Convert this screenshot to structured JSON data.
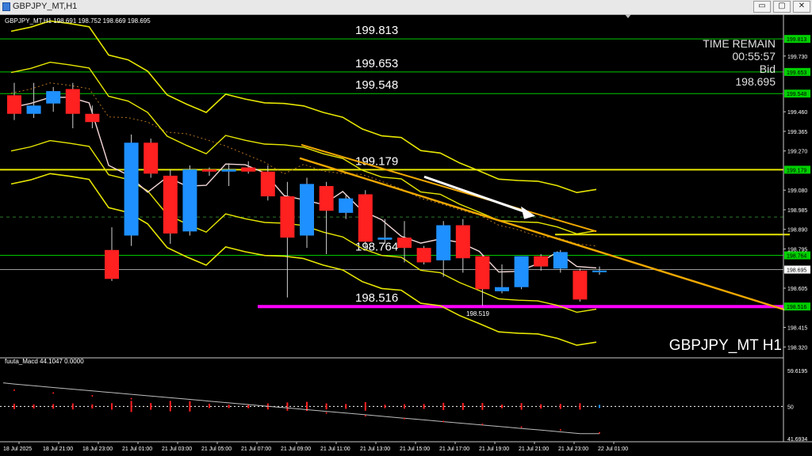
{
  "window": {
    "title": "GBPJPY_MT,H1",
    "min_glyph": "▭",
    "max_glyph": "▢",
    "close_glyph": "✕",
    "icons": [
      "app-icon",
      "minimize-icon",
      "restore-icon",
      "close-icon"
    ]
  },
  "chart_data": {
    "type": "candlestick",
    "symbol_header": "GBPJPY_MT,H1  198.691 198.752 198.669 198.695",
    "watermark": "GBPJPY_MT H1",
    "info_panel": {
      "time_remain_label": "TIME REMAIN",
      "time_remain": "00:55:57",
      "bid_label": "Bid",
      "bid": "198.695"
    },
    "y_range": [
      198.275,
      199.875
    ],
    "y_ticks": [
      "199.813",
      "199.730",
      "199.653",
      "199.548",
      "199.460",
      "199.365",
      "199.270",
      "199.179",
      "199.080",
      "198.985",
      "198.890",
      "198.795",
      "198.764",
      "198.695",
      "198.605",
      "198.516",
      "198.415",
      "198.320"
    ],
    "x_ticks": [
      "18 Jul 2025",
      "18 Jul 21:00",
      "18 Jul 23:00",
      "21 Jul 01:00",
      "21 Jul 03:00",
      "21 Jul 05:00",
      "21 Jul 07:00",
      "21 Jul 09:00",
      "21 Jul 11:00",
      "21 Jul 13:00",
      "21 Jul 15:00",
      "21 Jul 17:00",
      "21 Jul 19:00",
      "21 Jul 21:00",
      "21 Jul 23:00",
      "22 Jul 01:00"
    ],
    "candles": [
      {
        "o": 199.54,
        "h": 199.6,
        "l": 199.42,
        "c": 199.45
      },
      {
        "o": 199.45,
        "h": 199.6,
        "l": 199.43,
        "c": 199.49
      },
      {
        "o": 199.5,
        "h": 199.58,
        "l": 199.46,
        "c": 199.56
      },
      {
        "o": 199.57,
        "h": 199.6,
        "l": 199.38,
        "c": 199.45
      },
      {
        "o": 199.45,
        "h": 199.49,
        "l": 199.38,
        "c": 199.41
      },
      {
        "o": 198.79,
        "h": 198.9,
        "l": 198.64,
        "c": 198.65
      },
      {
        "o": 198.86,
        "h": 199.35,
        "l": 198.81,
        "c": 199.31
      },
      {
        "o": 199.31,
        "h": 199.33,
        "l": 199.14,
        "c": 199.16
      },
      {
        "o": 199.15,
        "h": 199.18,
        "l": 198.82,
        "c": 198.87
      },
      {
        "o": 198.88,
        "h": 199.2,
        "l": 198.86,
        "c": 199.18
      },
      {
        "o": 199.18,
        "h": 199.19,
        "l": 199.15,
        "c": 199.17
      },
      {
        "o": 199.17,
        "h": 199.21,
        "l": 199.1,
        "c": 199.18
      },
      {
        "o": 199.19,
        "h": 199.22,
        "l": 199.16,
        "c": 199.17
      },
      {
        "o": 199.17,
        "h": 199.2,
        "l": 199.03,
        "c": 199.05
      },
      {
        "o": 199.05,
        "h": 199.12,
        "l": 198.56,
        "c": 198.85
      },
      {
        "o": 198.86,
        "h": 199.14,
        "l": 198.8,
        "c": 199.11
      },
      {
        "o": 199.1,
        "h": 199.12,
        "l": 198.77,
        "c": 198.98
      },
      {
        "o": 198.97,
        "h": 199.06,
        "l": 198.94,
        "c": 199.04
      },
      {
        "o": 199.06,
        "h": 199.08,
        "l": 198.79,
        "c": 198.83
      },
      {
        "o": 198.84,
        "h": 198.94,
        "l": 198.82,
        "c": 198.85
      },
      {
        "o": 198.85,
        "h": 198.93,
        "l": 198.73,
        "c": 198.8
      },
      {
        "o": 198.8,
        "h": 198.81,
        "l": 198.72,
        "c": 198.73
      },
      {
        "o": 198.74,
        "h": 198.93,
        "l": 198.66,
        "c": 198.91
      },
      {
        "o": 198.91,
        "h": 198.94,
        "l": 198.68,
        "c": 198.75
      },
      {
        "o": 198.76,
        "h": 198.77,
        "l": 198.52,
        "c": 198.6
      },
      {
        "o": 198.59,
        "h": 198.72,
        "l": 198.58,
        "c": 198.61
      },
      {
        "o": 198.61,
        "h": 198.76,
        "l": 198.6,
        "c": 198.76
      },
      {
        "o": 198.76,
        "h": 198.77,
        "l": 198.69,
        "c": 198.71
      },
      {
        "o": 198.7,
        "h": 198.79,
        "l": 198.68,
        "c": 198.78
      },
      {
        "o": 198.69,
        "h": 198.7,
        "l": 198.54,
        "c": 198.55
      },
      {
        "o": 198.69,
        "h": 198.71,
        "l": 198.67,
        "c": 198.69
      }
    ],
    "horizontal_levels": [
      {
        "value": 199.813,
        "label": "199.813",
        "color": "#00c800"
      },
      {
        "value": 199.653,
        "label": "199.653",
        "color": "#00c800"
      },
      {
        "value": 199.548,
        "label": "199.548",
        "color": "#00c800"
      },
      {
        "value": 199.179,
        "label": "199.179",
        "color": "#e6e600"
      },
      {
        "value": 198.764,
        "label": "198.764",
        "color": "#00c800"
      },
      {
        "value": 198.516,
        "label": "198.516",
        "color": "#ff00ff"
      }
    ],
    "low_marker": "198.519",
    "highlighted_ticks": [
      "199.813",
      "199.653",
      "199.548",
      "199.179",
      "198.764",
      "198.516"
    ],
    "current_price_tick": "198.695",
    "macd": {
      "label": "fuuta_Macd 44.1047  0.0000",
      "y_ticks": [
        "59.6195",
        "50",
        "41.6934"
      ],
      "zero_level": 50
    },
    "colors": {
      "bull": "#1e90ff",
      "bear": "#ff2020",
      "band": "#e6e600",
      "ma": "#f4d7d7",
      "trendline": "#f0a800",
      "support": "#ff00ff",
      "level": "#00c800",
      "arrow": "#ffffff"
    },
    "grid": false
  }
}
